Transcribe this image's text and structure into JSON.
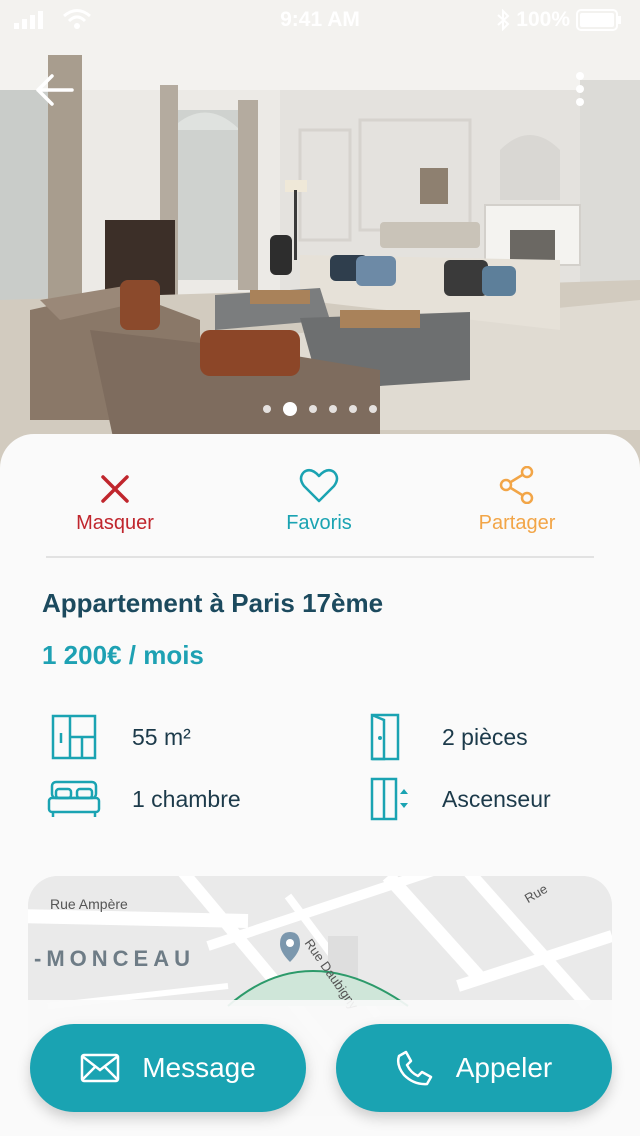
{
  "status_bar": {
    "time": "9:41 AM",
    "battery": "100%"
  },
  "gallery": {
    "photo_count": 6,
    "active_index": 1
  },
  "actions": {
    "hide": {
      "label": "Masquer",
      "color": "#c0262d"
    },
    "favorite": {
      "label": "Favoris",
      "color": "#1aa3b2"
    },
    "share": {
      "label": "Partager",
      "color": "#f2a547"
    }
  },
  "listing": {
    "title": "Appartement à Paris 17ème",
    "price": "1 200€ / mois",
    "features": [
      {
        "icon": "floor-plan-icon",
        "label": "55 m²"
      },
      {
        "icon": "door-icon",
        "label": "2 pièces"
      },
      {
        "icon": "bed-icon",
        "label": "1 chambre"
      },
      {
        "icon": "elevator-icon",
        "label": "Ascenseur"
      }
    ]
  },
  "map": {
    "street_1": "Rue Ampère",
    "street_2": "Rue Daubigny",
    "street_3": "Rue",
    "district": "-MONCEAU"
  },
  "buttons": {
    "message": {
      "label": "Message"
    },
    "call": {
      "label": "Appeler"
    }
  },
  "colors": {
    "accent": "#1aa3b2",
    "title": "#1c4a5e",
    "danger": "#c0262d",
    "share": "#f2a547"
  }
}
